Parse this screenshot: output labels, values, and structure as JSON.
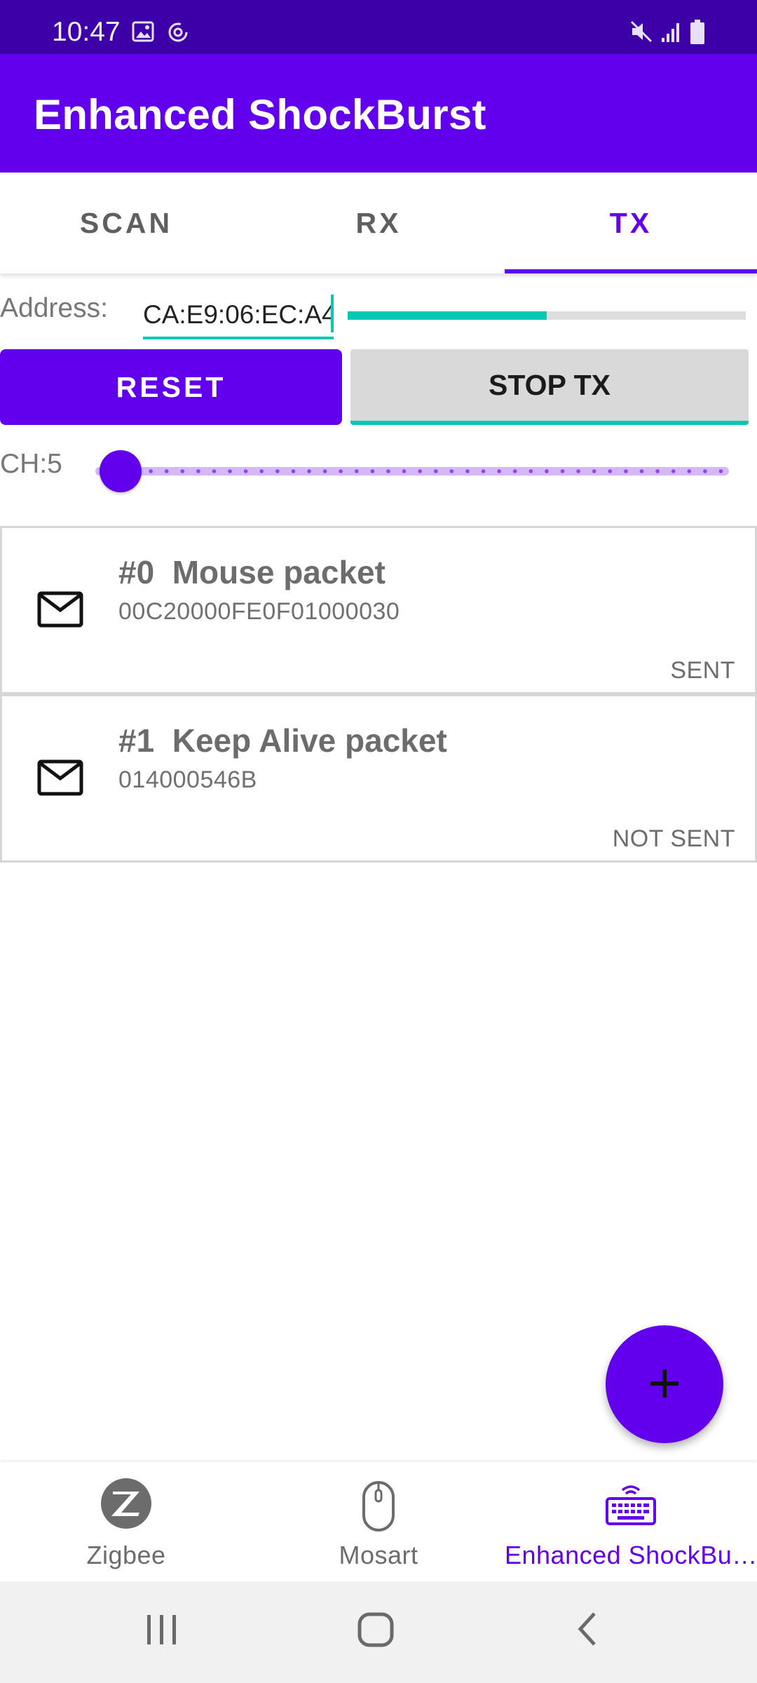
{
  "status_bar": {
    "time": "10:47",
    "left_icons": [
      "image-icon",
      "sync-icon"
    ],
    "right_icons": [
      "mute-icon",
      "signal-icon",
      "battery-icon"
    ]
  },
  "app_bar": {
    "title": "Enhanced ShockBurst"
  },
  "tabs": [
    {
      "label": "SCAN",
      "active": false
    },
    {
      "label": "RX",
      "active": false
    },
    {
      "label": "TX",
      "active": true
    }
  ],
  "address": {
    "label": "Address:",
    "value": "CA:E9:06:EC:A4",
    "progress_fraction": 0.5
  },
  "buttons": {
    "reset": "RESET",
    "stop_tx": "STOP TX"
  },
  "channel": {
    "label": "CH:5",
    "value": 5,
    "min": 0,
    "max": 125
  },
  "packets": [
    {
      "title": "#0  Mouse packet",
      "data": "00C20000FE0F01000030",
      "status": "SENT",
      "icon": "mail-icon"
    },
    {
      "title": "#1  Keep Alive packet",
      "data": "014000546B",
      "status": "NOT SENT",
      "icon": "mail-icon"
    }
  ],
  "fab": {
    "icon": "plus-icon"
  },
  "bottom_nav": [
    {
      "label": "Zigbee",
      "icon": "zigbee-icon",
      "active": false
    },
    {
      "label": "Mosart",
      "icon": "mouse-icon",
      "active": false
    },
    {
      "label": "Enhanced ShockBu…",
      "icon": "keyboard-wireless-icon",
      "active": true
    }
  ],
  "colors": {
    "primary": "#6200ee",
    "primary_dark": "#3d00a8",
    "accent": "#00c8b4"
  }
}
